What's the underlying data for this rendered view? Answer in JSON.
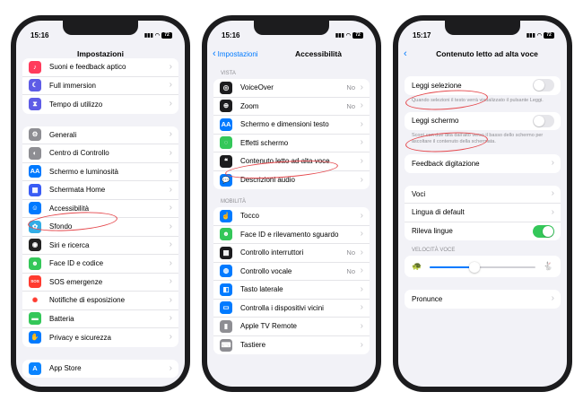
{
  "colors": {
    "blue": "#007aff",
    "green": "#34c759",
    "annotation": "#e5484d"
  },
  "phones": [
    {
      "time": "15:16",
      "battery": "72",
      "title": "Impostazioni",
      "groups": [
        [
          {
            "label": "Suoni e feedback aptico",
            "icon": "speaker-icon",
            "glyph": "♪",
            "color": "#ff3b5c"
          },
          {
            "label": "Full immersion",
            "icon": "moon-icon",
            "glyph": "☾",
            "color": "#5e5ce6"
          },
          {
            "label": "Tempo di utilizzo",
            "icon": "hourglass-icon",
            "glyph": "⧗",
            "color": "#5e5ce6"
          }
        ],
        [
          {
            "label": "Generali",
            "icon": "gear-icon",
            "glyph": "⚙",
            "color": "#8e8e93"
          },
          {
            "label": "Centro di Controllo",
            "icon": "switches-icon",
            "glyph": "◐",
            "color": "#8e8e93"
          },
          {
            "label": "Schermo e luminosità",
            "icon": "brightness-icon",
            "glyph": "AA",
            "color": "#007aff"
          },
          {
            "label": "Schermata Home",
            "icon": "home-grid-icon",
            "glyph": "▦",
            "color": "#3a5cf5"
          },
          {
            "label": "Accessibilità",
            "icon": "accessibility-icon",
            "glyph": "☺",
            "color": "#007aff"
          },
          {
            "label": "Sfondo",
            "icon": "wallpaper-icon",
            "glyph": "✿",
            "color": "#32ade6"
          },
          {
            "label": "Siri e ricerca",
            "icon": "siri-icon",
            "glyph": "◉",
            "color": "#222222"
          },
          {
            "label": "Face ID e codice",
            "icon": "faceid-icon",
            "glyph": "☻",
            "color": "#34c759"
          },
          {
            "label": "SOS emergenze",
            "icon": "sos-icon",
            "glyph": "SOS",
            "color": "#ff3b30"
          },
          {
            "label": "Notifiche di esposizione",
            "icon": "exposure-icon",
            "glyph": "✺",
            "color": "#ffffff",
            "fg": "#ff3b30"
          },
          {
            "label": "Batteria",
            "icon": "battery-icon",
            "glyph": "▬",
            "color": "#34c759"
          },
          {
            "label": "Privacy e sicurezza",
            "icon": "hand-icon",
            "glyph": "✋",
            "color": "#007aff"
          }
        ],
        [
          {
            "label": "App Store",
            "icon": "appstore-icon",
            "glyph": "A",
            "color": "#0a84ff"
          }
        ]
      ]
    },
    {
      "time": "15:16",
      "battery": "72",
      "title": "Accessibilità",
      "back": "Impostazioni",
      "sections": [
        {
          "header": "VISTA",
          "rows": [
            {
              "label": "VoiceOver",
              "value": "No",
              "icon": "voiceover-icon",
              "glyph": "◎",
              "color": "#1c1c1e"
            },
            {
              "label": "Zoom",
              "value": "No",
              "icon": "zoom-icon",
              "glyph": "⊕",
              "color": "#1c1c1e"
            },
            {
              "label": "Schermo e dimensioni testo",
              "icon": "text-size-icon",
              "glyph": "AA",
              "color": "#007aff"
            },
            {
              "label": "Effetti schermo",
              "icon": "motion-icon",
              "glyph": "◌",
              "color": "#34c759"
            },
            {
              "label": "Contenuto letto ad alta voce",
              "icon": "speech-bubble-icon",
              "glyph": "❝",
              "color": "#1c1c1e"
            },
            {
              "label": "Descrizioni audio",
              "icon": "audio-description-icon",
              "glyph": "💬",
              "color": "#007aff"
            }
          ]
        },
        {
          "header": "MOBILITÀ",
          "rows": [
            {
              "label": "Tocco",
              "icon": "touch-icon",
              "glyph": "☝",
              "color": "#007aff"
            },
            {
              "label": "Face ID e rilevamento sguardo",
              "icon": "faceid-icon",
              "glyph": "☻",
              "color": "#34c759"
            },
            {
              "label": "Controllo interruttori",
              "value": "No",
              "icon": "switch-control-icon",
              "glyph": "▦",
              "color": "#1c1c1e"
            },
            {
              "label": "Controllo vocale",
              "value": "No",
              "icon": "voice-control-icon",
              "glyph": "◍",
              "color": "#007aff"
            },
            {
              "label": "Tasto laterale",
              "icon": "side-button-icon",
              "glyph": "◧",
              "color": "#007aff"
            },
            {
              "label": "Controlla i dispositivi vicini",
              "icon": "devices-icon",
              "glyph": "▭",
              "color": "#007aff"
            },
            {
              "label": "Apple TV Remote",
              "icon": "remote-icon",
              "glyph": "▮",
              "color": "#8e8e93"
            },
            {
              "label": "Tastiere",
              "icon": "keyboard-icon",
              "glyph": "⌨",
              "color": "#8e8e93"
            }
          ]
        }
      ]
    },
    {
      "time": "15:17",
      "battery": "72",
      "title": "Contenuto letto ad alta voce",
      "leggi_selezione": {
        "label": "Leggi selezione",
        "on": false,
        "footnote": "Quando selezioni il testo verrà visualizzato il pulsante Leggi."
      },
      "leggi_schermo": {
        "label": "Leggi schermo",
        "on": false,
        "footnote": "Scorri con due dita dall'alto verso il basso dello schermo per ascoltare il contenuto della schermata."
      },
      "feedback": "Feedback digitazione",
      "voci": "Voci",
      "lingua": "Lingua di default",
      "rileva": {
        "label": "Rileva lingue",
        "on": true
      },
      "speed_label": "VELOCITÀ VOCE",
      "speed_value": 0.42,
      "pronunce": "Pronunce"
    }
  ]
}
